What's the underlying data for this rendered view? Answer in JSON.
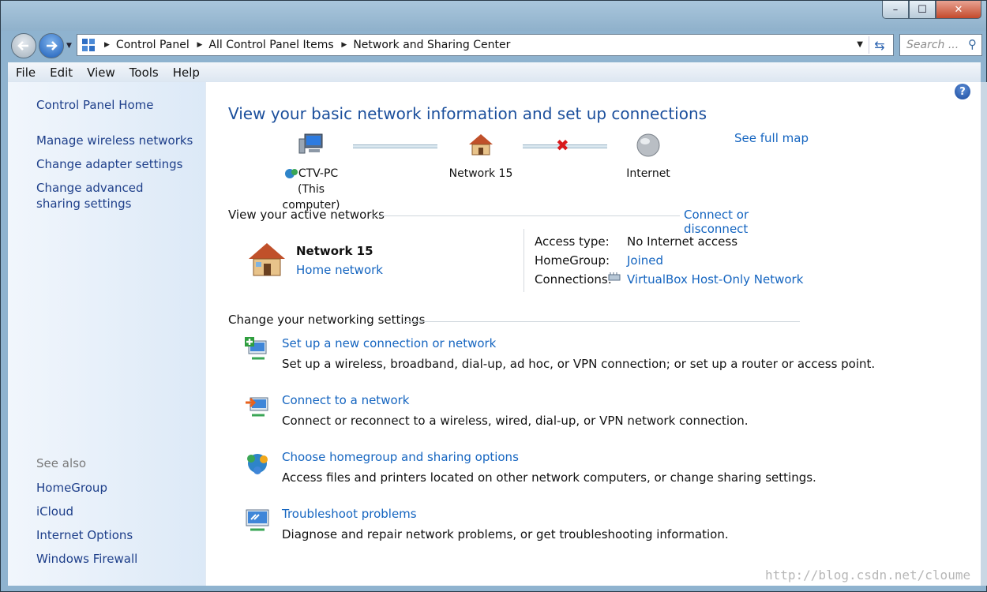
{
  "window": {
    "controls": {
      "minimize": "–",
      "maximize": "☐",
      "close": "✕"
    }
  },
  "nav": {
    "breadcrumbs": [
      "Control Panel",
      "All Control Panel Items",
      "Network and Sharing Center"
    ],
    "search_placeholder": "Search ..."
  },
  "menu": [
    "File",
    "Edit",
    "View",
    "Tools",
    "Help"
  ],
  "sidebar": {
    "home": "Control Panel Home",
    "items": [
      "Manage wireless networks",
      "Change adapter settings",
      "Change advanced sharing settings"
    ],
    "see_also_label": "See also",
    "see_also": [
      "HomeGroup",
      "iCloud",
      "Internet Options",
      "Windows Firewall"
    ]
  },
  "main": {
    "heading": "View your basic network information and set up connections",
    "see_full_map": "See full map",
    "map": {
      "computer_name": "CTV-PC",
      "computer_sub": "(This computer)",
      "network": "Network  15",
      "internet": "Internet"
    },
    "active_networks": {
      "title": "View your active networks",
      "connect_link": "Connect or disconnect",
      "network_name": "Network  15",
      "network_type": "Home network",
      "access_type_label": "Access type:",
      "access_type_value": "No Internet access",
      "homegroup_label": "HomeGroup:",
      "homegroup_value": "Joined",
      "connections_label": "Connections:",
      "connections_value": "VirtualBox Host-Only Network"
    },
    "settings": {
      "title": "Change your networking settings",
      "tasks": [
        {
          "link": "Set up a new connection or network",
          "desc": "Set up a wireless, broadband, dial-up, ad hoc, or VPN connection; or set up a router or access point."
        },
        {
          "link": "Connect to a network",
          "desc": "Connect or reconnect to a wireless, wired, dial-up, or VPN network connection."
        },
        {
          "link": "Choose homegroup and sharing options",
          "desc": "Access files and printers located on other network computers, or change sharing settings."
        },
        {
          "link": "Troubleshoot problems",
          "desc": "Diagnose and repair network problems, or get troubleshooting information."
        }
      ]
    }
  },
  "help_glyph": "?",
  "watermark": "http://blog.csdn.net/cloume"
}
